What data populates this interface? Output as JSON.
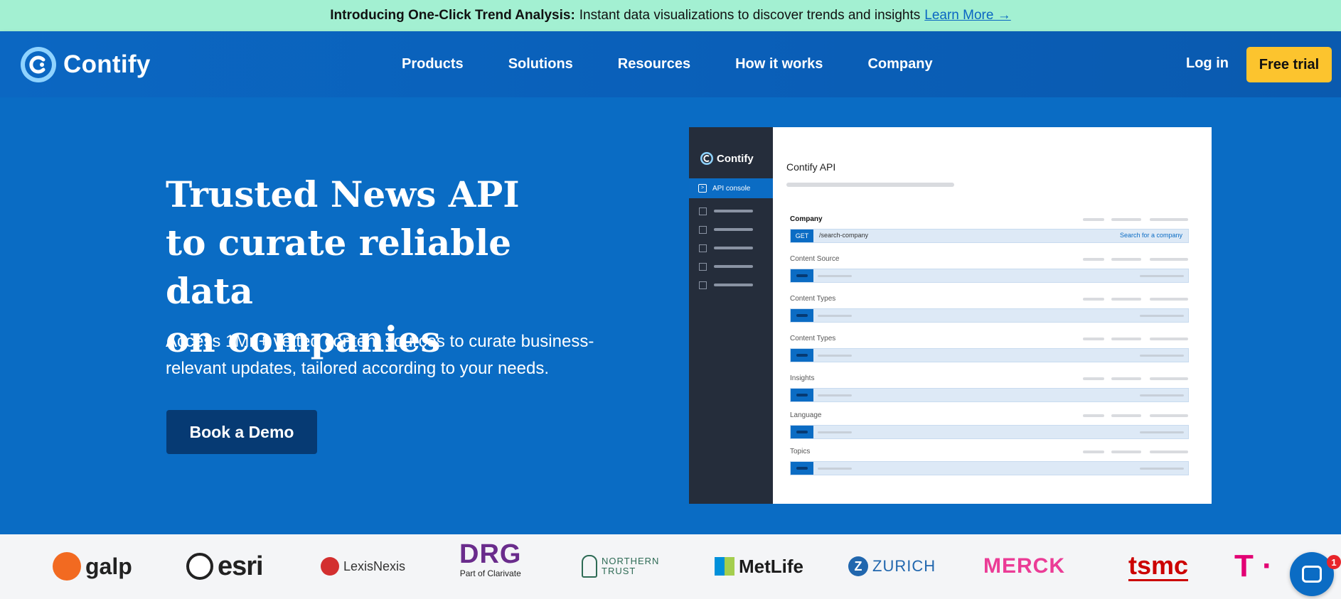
{
  "announcement": {
    "bold": "Introducing One-Click Trend Analysis:",
    "text": "Instant data visualizations to discover trends and insights",
    "link": "Learn More →"
  },
  "header": {
    "brand": "Contify",
    "nav": [
      "Products",
      "Solutions",
      "Resources",
      "How it works",
      "Company"
    ],
    "login": "Log in",
    "cta": "Free trial"
  },
  "hero": {
    "title_lines": [
      "Trusted News API",
      "to curate reliable data",
      "on companies"
    ],
    "lead": "Access 1Mn+ vetted content sources to curate business-relevant updates, tailored according to your needs.",
    "cta": "Book a Demo"
  },
  "console": {
    "brand": "Contify",
    "active_item": "API console",
    "title": "Contify API",
    "sections": [
      {
        "label": "Company",
        "method": "GET",
        "path": "/search-company",
        "action": "Search for a company"
      },
      {
        "label": "Content Source"
      },
      {
        "label": "Content Types"
      },
      {
        "label": "Content Types"
      },
      {
        "label": "Insights"
      },
      {
        "label": "Language"
      },
      {
        "label": "Topics"
      }
    ]
  },
  "logos": {
    "galp": "galp",
    "esri": "esri",
    "lexis": "LexisNexis",
    "drg": "DRG",
    "drg_sub": "Part of Clarivate",
    "northern_trust": [
      "NORTHERN",
      "TRUST"
    ],
    "metlife": "MetLife",
    "zurich": "ZURICH",
    "merck": "MERCK",
    "tsmc": "tsmc",
    "tmobile": "T ·"
  },
  "chat": {
    "badge": "1"
  }
}
